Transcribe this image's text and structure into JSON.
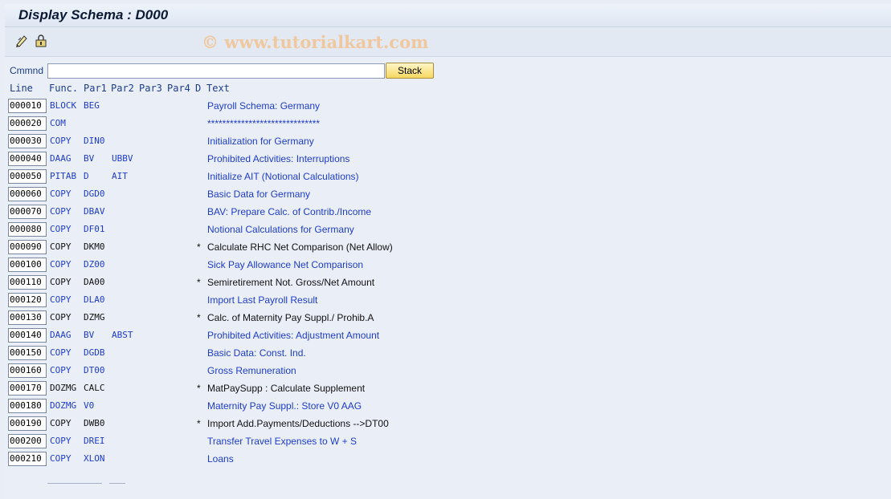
{
  "window": {
    "title": "Display Schema : D000"
  },
  "watermark": "© www.tutorialkart.com",
  "toolbar": {
    "icons": [
      "edit-icon",
      "lock-icon"
    ]
  },
  "command": {
    "label": "Cmmnd",
    "value": "",
    "stack_label": "Stack"
  },
  "columns": [
    "Line",
    "Func.",
    "Par1",
    "Par2",
    "Par3",
    "Par4",
    "D",
    "Text"
  ],
  "rows": [
    {
      "line": "000010",
      "func": "BLOCK",
      "par1": "BEG",
      "par2": "",
      "star": "",
      "text": "Payroll Schema: Germany",
      "active": true
    },
    {
      "line": "000020",
      "func": "COM",
      "par1": "",
      "par2": "",
      "star": "",
      "text": "******************************",
      "active": true
    },
    {
      "line": "000030",
      "func": "COPY",
      "par1": "DIN0",
      "par2": "",
      "star": "",
      "text": "Initialization for Germany",
      "active": true
    },
    {
      "line": "000040",
      "func": "DAAG",
      "par1": "BV",
      "par2": "UBBV",
      "star": "",
      "text": "Prohibited Activities: Interruptions",
      "active": true
    },
    {
      "line": "000050",
      "func": "PITAB",
      "par1": "D",
      "par2": "AIT",
      "star": "",
      "text": "Initialize AIT (Notional Calculations)",
      "active": true
    },
    {
      "line": "000060",
      "func": "COPY",
      "par1": "DGD0",
      "par2": "",
      "star": "",
      "text": "Basic Data for Germany",
      "active": true
    },
    {
      "line": "000070",
      "func": "COPY",
      "par1": "DBAV",
      "par2": "",
      "star": "",
      "text": "BAV: Prepare Calc. of Contrib./Income",
      "active": true
    },
    {
      "line": "000080",
      "func": "COPY",
      "par1": "DF01",
      "par2": "",
      "star": "",
      "text": "Notional Calculations for Germany",
      "active": true
    },
    {
      "line": "000090",
      "func": "COPY",
      "par1": "DKM0",
      "par2": "",
      "star": "*",
      "text": "Calculate RHC Net Comparison (Net Allow)",
      "active": false
    },
    {
      "line": "000100",
      "func": "COPY",
      "par1": "DZ00",
      "par2": "",
      "star": "",
      "text": "Sick Pay Allowance Net Comparison",
      "active": true
    },
    {
      "line": "000110",
      "func": "COPY",
      "par1": "DA00",
      "par2": "",
      "star": "*",
      "text": "Semiretirement Not. Gross/Net Amount",
      "active": false
    },
    {
      "line": "000120",
      "func": "COPY",
      "par1": "DLA0",
      "par2": "",
      "star": "",
      "text": "Import Last Payroll Result",
      "active": true
    },
    {
      "line": "000130",
      "func": "COPY",
      "par1": "DZMG",
      "par2": "",
      "star": "*",
      "text": "Calc. of Maternity Pay Suppl./ Prohib.A",
      "active": false
    },
    {
      "line": "000140",
      "func": "DAAG",
      "par1": "BV",
      "par2": "ABST",
      "star": "",
      "text": "Prohibited Activities: Adjustment Amount",
      "active": true
    },
    {
      "line": "000150",
      "func": "COPY",
      "par1": "DGDB",
      "par2": "",
      "star": "",
      "text": "Basic Data: Const. Ind.",
      "active": true
    },
    {
      "line": "000160",
      "func": "COPY",
      "par1": "DT00",
      "par2": "",
      "star": "",
      "text": "Gross Remuneration",
      "active": true
    },
    {
      "line": "000170",
      "func": "DOZMG",
      "par1": "CALC",
      "par2": "",
      "star": "*",
      "text": "MatPaySupp : Calculate Supplement",
      "active": false
    },
    {
      "line": "000180",
      "func": "DOZMG",
      "par1": "V0",
      "par2": "",
      "star": "",
      "text": "Maternity Pay Suppl.: Store V0 AAG",
      "active": true
    },
    {
      "line": "000190",
      "func": "COPY",
      "par1": "DWB0",
      "par2": "",
      "star": "*",
      "text": "Import Add.Payments/Deductions -->DT00",
      "active": false
    },
    {
      "line": "000200",
      "func": "COPY",
      "par1": "DREI",
      "par2": "",
      "star": "",
      "text": "Transfer Travel Expenses to W + S",
      "active": true
    },
    {
      "line": "000210",
      "func": "COPY",
      "par1": "XLON",
      "par2": "",
      "star": "",
      "text": "Loans",
      "active": true
    }
  ]
}
